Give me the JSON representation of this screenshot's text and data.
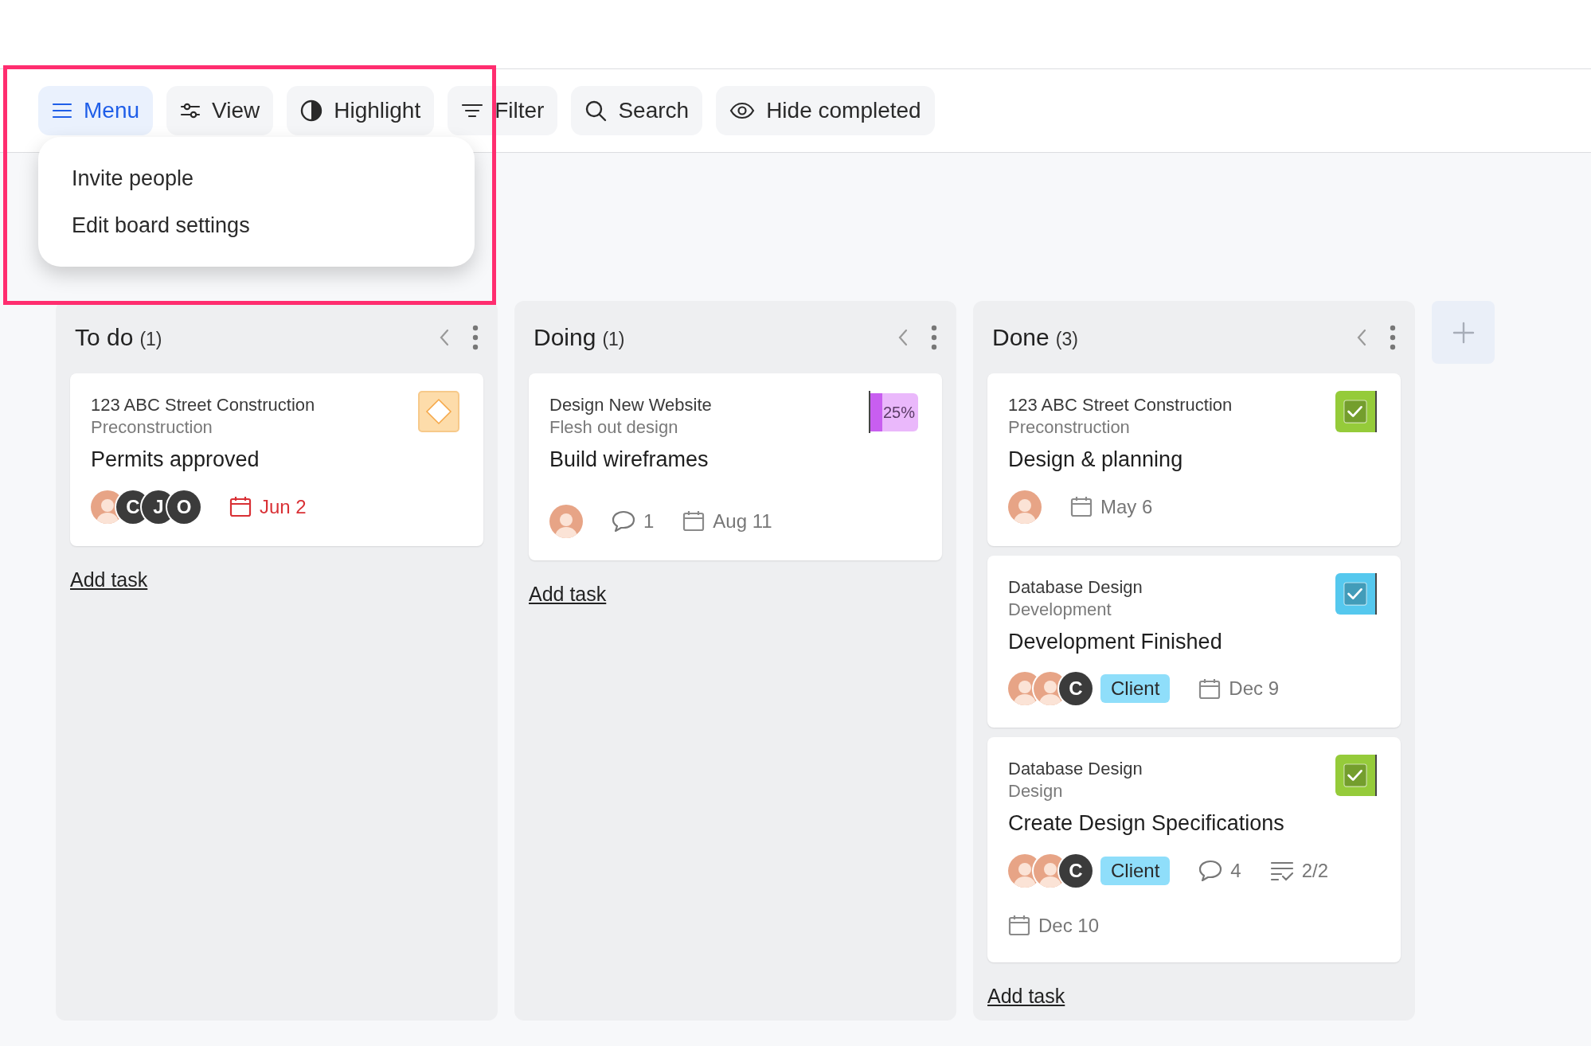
{
  "toolbar": [
    {
      "kind": "menu",
      "label": "Menu",
      "selected": true
    },
    {
      "kind": "view",
      "label": "View",
      "selected": false
    },
    {
      "kind": "highlight",
      "label": "Highlight",
      "selected": false
    },
    {
      "kind": "filter",
      "label": "Filter",
      "selected": false
    },
    {
      "kind": "search",
      "label": "Search",
      "selected": false
    },
    {
      "kind": "hide",
      "label": "Hide completed",
      "selected": false
    }
  ],
  "menu": {
    "items": [
      "Invite people",
      "Edit board settings"
    ]
  },
  "columns": [
    {
      "title": "To do",
      "count": "(1)",
      "add_task": "Add task",
      "cards": [
        {
          "project": "123 ABC Street Construction",
          "section": "Preconstruction",
          "title": "Permits approved",
          "badge": {
            "kind": "milestone"
          },
          "assignees": [
            {
              "kind": "photo"
            },
            {
              "kind": "initial",
              "initial": "C"
            },
            {
              "kind": "initial",
              "initial": "J"
            },
            {
              "kind": "initial",
              "initial": "O"
            }
          ],
          "due": {
            "date": "Jun 2",
            "overdue": true
          }
        }
      ]
    },
    {
      "title": "Doing",
      "count": "(1)",
      "add_task": "Add task",
      "cards": [
        {
          "project": "Design New Website",
          "section": "Flesh out design",
          "title": "Build wireframes",
          "badge": {
            "kind": "progress",
            "level": 0.25,
            "label": "25%"
          },
          "assignees": [
            {
              "kind": "photo"
            }
          ],
          "comments": "1",
          "due": {
            "date": "Aug 11",
            "overdue": false
          }
        }
      ]
    },
    {
      "title": "Done",
      "count": "(3)",
      "add_task": "Add task",
      "cards": [
        {
          "project": "123 ABC Street Construction",
          "section": "Preconstruction",
          "title": "Design & planning",
          "badge": {
            "kind": "checkbox",
            "checked": true,
            "color": "#95cb3a"
          },
          "assignees": [
            {
              "kind": "photo"
            }
          ],
          "due": {
            "date": "May 6",
            "overdue": false
          }
        },
        {
          "project": "Database Design",
          "section": "Development",
          "title": "Development Finished",
          "badge": {
            "kind": "checkbox",
            "checked": true,
            "color": "#55c8ee"
          },
          "assignees": [
            {
              "kind": "photo"
            },
            {
              "kind": "photo"
            },
            {
              "kind": "initial",
              "initial": "C"
            }
          ],
          "tag": "Client",
          "due": {
            "date": "Dec 9",
            "overdue": false
          }
        },
        {
          "project": "Database Design",
          "section": "Design",
          "title": "Create Design Specifications",
          "badge": {
            "kind": "checkbox",
            "checked": true,
            "color": "#95cb3a"
          },
          "assignees": [
            {
              "kind": "photo"
            },
            {
              "kind": "photo"
            },
            {
              "kind": "initial",
              "initial": "C"
            }
          ],
          "tag": "Client",
          "comments": "4",
          "subtasks": "2/2",
          "due": {
            "date": "Dec 10",
            "overdue": false
          }
        }
      ]
    }
  ]
}
